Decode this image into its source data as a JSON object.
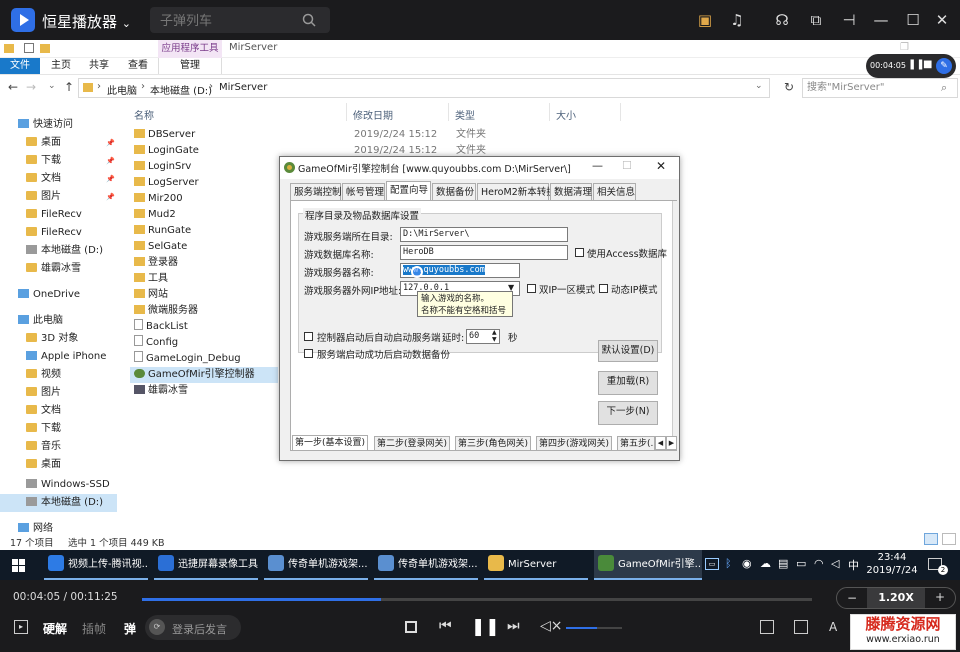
{
  "player": {
    "app_name": "恒星播放器",
    "search_placeholder": "子弹列车",
    "current_time": "00:04:05",
    "total_time": "00:11:25",
    "time_sep": "/",
    "progress": 0.357,
    "mini_time": "00:04:05",
    "speed": "1.20X",
    "speed_minus": "−",
    "speed_plus": "+",
    "btn_harden": "硬解",
    "btn_insert": "插帧",
    "btn_danmaku": "弹",
    "comment_placeholder": "登录后发言",
    "volume": 0.55
  },
  "explorer": {
    "ribbon_context_label": "应用程序工具",
    "ribbon_title": "MirServer",
    "tabs": [
      "文件",
      "主页",
      "共享",
      "查看",
      "管理"
    ],
    "breadcrumb": [
      "此电脑",
      "本地磁盘 (D:)",
      "MirServer"
    ],
    "search_placeholder": "搜索\"MirServer\"",
    "columns": [
      "名称",
      "修改日期",
      "类型",
      "大小"
    ],
    "sidebar": [
      {
        "label": "快速访问",
        "type": "star"
      },
      {
        "label": "桌面",
        "type": "folder"
      },
      {
        "label": "下载",
        "type": "folder"
      },
      {
        "label": "文档",
        "type": "folder"
      },
      {
        "label": "图片",
        "type": "folder"
      },
      {
        "label": "FileRecv",
        "type": "folder"
      },
      {
        "label": "FileRecv",
        "type": "folder"
      },
      {
        "label": "本地磁盘 (D:)",
        "type": "drive"
      },
      {
        "label": "雄霸冰雪",
        "type": "folder"
      },
      {
        "label": "OneDrive",
        "type": "cloud"
      },
      {
        "label": "此电脑",
        "type": "pc"
      },
      {
        "label": "3D 对象",
        "type": "folder"
      },
      {
        "label": "Apple iPhone",
        "type": "phone"
      },
      {
        "label": "视频",
        "type": "folder"
      },
      {
        "label": "图片",
        "type": "folder"
      },
      {
        "label": "文档",
        "type": "folder"
      },
      {
        "label": "下载",
        "type": "folder"
      },
      {
        "label": "音乐",
        "type": "folder"
      },
      {
        "label": "桌面",
        "type": "folder"
      },
      {
        "label": "Windows-SSD (C:)",
        "type": "drive"
      },
      {
        "label": "本地磁盘 (D:)",
        "type": "drive"
      },
      {
        "label": "网络",
        "type": "pc"
      }
    ],
    "files": [
      {
        "name": "DBServer",
        "date": "2019/2/24 15:12",
        "type": "文件夹"
      },
      {
        "name": "LoginGate",
        "date": "2019/2/24 15:12",
        "type": "文件夹"
      },
      {
        "name": "LoginSrv",
        "date": "",
        "type": ""
      },
      {
        "name": "LogServer",
        "date": "",
        "type": ""
      },
      {
        "name": "Mir200",
        "date": "",
        "type": ""
      },
      {
        "name": "Mud2",
        "date": "",
        "type": ""
      },
      {
        "name": "RunGate",
        "date": "",
        "type": ""
      },
      {
        "name": "SelGate",
        "date": "",
        "type": ""
      },
      {
        "name": "登录器",
        "date": "",
        "type": ""
      },
      {
        "name": "工具",
        "date": "",
        "type": ""
      },
      {
        "name": "网站",
        "date": "",
        "type": ""
      },
      {
        "name": "微端服务器",
        "date": "",
        "type": ""
      },
      {
        "name": "BackList",
        "date": "",
        "type": ""
      },
      {
        "name": "Config",
        "date": "",
        "type": ""
      },
      {
        "name": "GameLogin_Debug",
        "date": "",
        "type": ""
      },
      {
        "name": "GameOfMir引擎控制器",
        "date": "",
        "type": ""
      },
      {
        "name": "雄霸冰雪",
        "date": "",
        "type": ""
      }
    ],
    "status_count": "17 个项目",
    "status_selected": "选中 1 个项目  449 KB"
  },
  "dialog": {
    "title": "GameOfMir引擎控制台 [www.quyoubbs.com D:\\MirServer\\]",
    "tabs": [
      "服务端控制",
      "帐号管理",
      "配置向导",
      "数据备份",
      "HeroM2新本转换",
      "数据清理",
      "相关信息"
    ],
    "group_title": "程序目录及物品数据库设置",
    "label_dir": "游戏服务端所在目录:",
    "value_dir": "D:\\MirServer\\",
    "label_db": "游戏数据库名称:",
    "value_db": "HeroDB",
    "check_access": "使用Access数据库",
    "label_server_name": "游戏服务器名称:",
    "value_server_name": "www.quyoubbs.com",
    "label_ip": "游戏服务器外网IP地址:",
    "value_ip": "127.0.0.1",
    "check_dual_ip": "双IP一区模式",
    "check_dynamic_ip": "动态IP模式",
    "tooltip_line1": "输入游戏的名称。",
    "tooltip_line2": "名称不能有空格和括号",
    "check_autostart": "控制器启动后自动启动服务端",
    "label_delay": "延时:",
    "value_delay": "60",
    "label_seconds": "秒",
    "check_backup": "服务端启动成功后启动数据备份",
    "btn_default": "默认设置(D)",
    "btn_reload": "重加载(R)",
    "btn_next": "下一步(N)",
    "step_tabs": [
      "第一步(基本设置)",
      "第二步(登录网关)",
      "第三步(角色网关)",
      "第四步(游戏网关)",
      "第五步(..."
    ]
  },
  "taskbar": {
    "items": [
      {
        "label": "视频上传-腾讯视...",
        "color": "#2d7be5"
      },
      {
        "label": "迅捷屏幕录像工具",
        "color": "#2b6fd6"
      },
      {
        "label": "传奇单机游戏架...",
        "color": "#5a8fd0"
      },
      {
        "label": "传奇单机游戏架...",
        "color": "#5a8fd0"
      },
      {
        "label": "MirServer",
        "color": "#e8b94a"
      },
      {
        "label": "GameOfMir引擎...",
        "color": "#4a8a3a"
      }
    ],
    "ime": "中",
    "clock_time": "23:44",
    "clock_date": "2019/7/24",
    "notif_count": "2"
  },
  "watermark": {
    "name": "滕腾资源网",
    "url": "www.erxiao.run"
  }
}
